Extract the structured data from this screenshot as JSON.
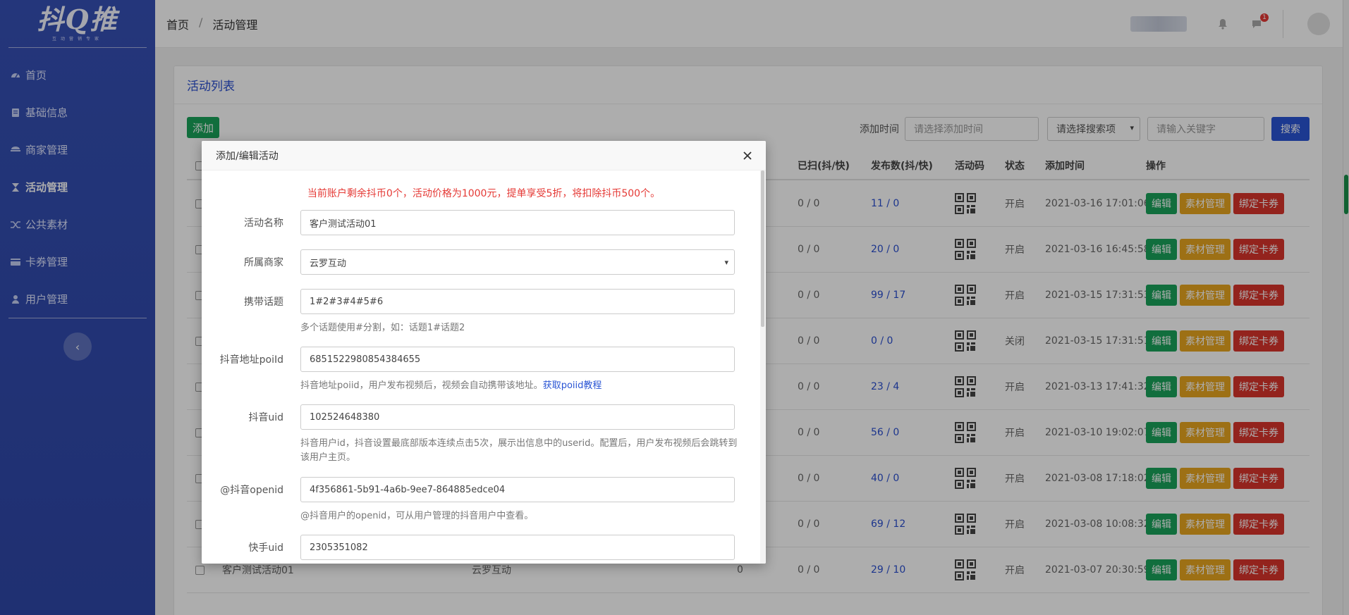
{
  "logo": {
    "main": "抖Q推",
    "sub": "互动营销专家"
  },
  "sidebar": {
    "items": [
      {
        "label": "首页",
        "icon": "dashboard-icon",
        "active": false
      },
      {
        "label": "基础信息",
        "icon": "document-icon",
        "active": false
      },
      {
        "label": "商家管理",
        "icon": "merchant-icon",
        "active": false
      },
      {
        "label": "活动管理",
        "icon": "hourglass-icon",
        "active": true
      },
      {
        "label": "公共素材",
        "icon": "shuffle-icon",
        "active": false
      },
      {
        "label": "卡券管理",
        "icon": "card-icon",
        "active": false
      },
      {
        "label": "用户管理",
        "icon": "user-icon",
        "active": false
      }
    ],
    "collapse_label": "‹"
  },
  "header": {
    "breadcrumb": [
      "首页",
      "/",
      "活动管理"
    ],
    "message_badge": "1"
  },
  "card": {
    "title": "活动列表",
    "add_label": "添加",
    "filter": {
      "time_label": "添加时间",
      "time_placeholder": "请选择添加时间",
      "search_select": "请选择搜索项",
      "keyword_placeholder": "请输入关键字",
      "search_label": "搜索"
    }
  },
  "table": {
    "headers": {
      "scanned": "已扫(抖/快)",
      "published": "发布数(抖/快)",
      "code": "活动码",
      "status": "状态",
      "time": "添加时间",
      "ops": "操作"
    },
    "op_labels": {
      "edit": "编辑",
      "material": "素材管理",
      "bind": "绑定卡券"
    },
    "rows": [
      {
        "scanned": "0 / 0",
        "published": "11 / 0",
        "status": "开启",
        "time": "2021-03-16 17:01:06"
      },
      {
        "scanned": "0 / 0",
        "published": "20 / 0",
        "status": "开启",
        "time": "2021-03-16 16:45:58"
      },
      {
        "scanned": "0 / 0",
        "published": "99 / 17",
        "status": "开启",
        "time": "2021-03-15 17:31:53"
      },
      {
        "scanned": "0 / 0",
        "published": "0 / 0",
        "status": "关闭",
        "time": "2021-03-15 17:31:51"
      },
      {
        "scanned": "0 / 0",
        "published": "23 / 4",
        "status": "开启",
        "time": "2021-03-13 17:41:32"
      },
      {
        "scanned": "0 / 0",
        "published": "56 / 0",
        "status": "开启",
        "time": "2021-03-10 19:02:07"
      },
      {
        "scanned": "0 / 0",
        "published": "40 / 0",
        "status": "开启",
        "time": "2021-03-08 17:18:02"
      },
      {
        "scanned": "0 / 0",
        "published": "69 / 12",
        "status": "开启",
        "time": "2021-03-08 10:08:32"
      },
      {
        "name": "客户测试活动01",
        "merchant": "云罗互动",
        "price": "0",
        "scanned": "0 / 0",
        "published": "29 / 10",
        "status": "开启",
        "time": "2021-03-07 20:30:59"
      }
    ]
  },
  "modal": {
    "title": "添加/编辑活动",
    "notice": "当前账户剩余抖币0个，活动价格为1000元，提单享受5折，将扣除抖币500个。",
    "fields": {
      "name": {
        "label": "活动名称",
        "value": "客户测试活动01"
      },
      "merchant": {
        "label": "所属商家",
        "value": "云罗互动"
      },
      "topics": {
        "label": "携带话题",
        "value": "1#2#3#4#5#6",
        "help": "多个话题使用#分割，如：话题1#话题2"
      },
      "poi": {
        "label": "抖音地址poiId",
        "value": "6851522980854384655",
        "help": "抖音地址poiid，用户发布视频后，视频会自动携带该地址。",
        "link": "获取poiid教程"
      },
      "douyin_uid": {
        "label": "抖音uid",
        "value": "102524648380",
        "help": "抖音用户id，抖音设置最底部版本连续点击5次，展示出信息中的userid。配置后，用户发布视频后会跳转到该用户主页。"
      },
      "openid": {
        "label": "@抖音openid",
        "value": "4f356861-5b91-4a6b-9ee7-864885edce04",
        "help": "@抖音用户的openid，可从用户管理的抖音用户中查看。"
      },
      "kuaishou_uid": {
        "label": "快手uid",
        "value": "2305351082"
      }
    }
  }
}
